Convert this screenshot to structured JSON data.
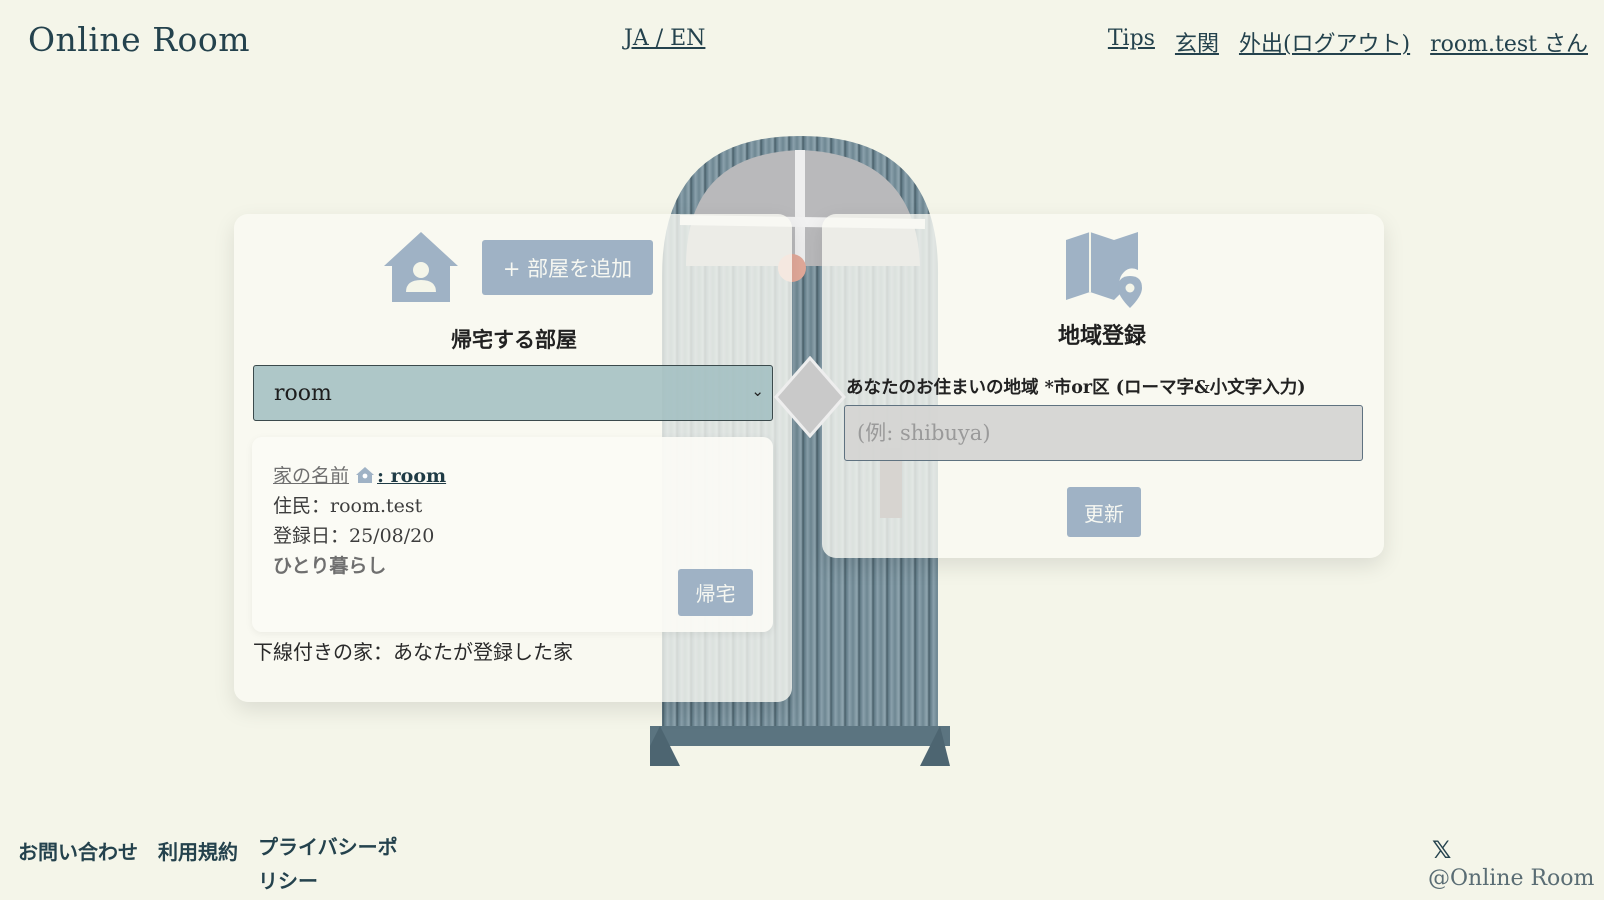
{
  "header": {
    "logo": "Online Room",
    "lang_toggle": "JA / EN",
    "nav": [
      "Tips",
      "玄関",
      "外出(ログアウト)",
      "room.test さん"
    ]
  },
  "left_panel": {
    "add_room_label": "+ 部屋を追加",
    "title": "帰宅する部屋",
    "selected_room": "room",
    "room_card": {
      "name_label": "家の名前",
      "name_value": ": room",
      "resident": "住民：room.test",
      "registered": "登録日：25/08/20",
      "living": "ひとり暮らし",
      "go_home_label": "帰宅"
    },
    "legend": "下線付きの家：あなたが登録した家"
  },
  "right_panel": {
    "title": "地域登録",
    "region_label": "あなたのお住まいの地域 *市or区 (ローマ字&小文字入力)",
    "region_placeholder": "(例: shibuya)",
    "update_label": "更新"
  },
  "footer": {
    "links": [
      "お問い合わせ",
      "利用規約",
      "プライバシーポリシー"
    ],
    "x_icon": "𝕏",
    "handle": "@Online Room"
  },
  "colors": {
    "background": "#f4f5e9",
    "accent_button": "#9fb2c5",
    "select_bg": "#a3bfc1",
    "link": "#24424d"
  }
}
